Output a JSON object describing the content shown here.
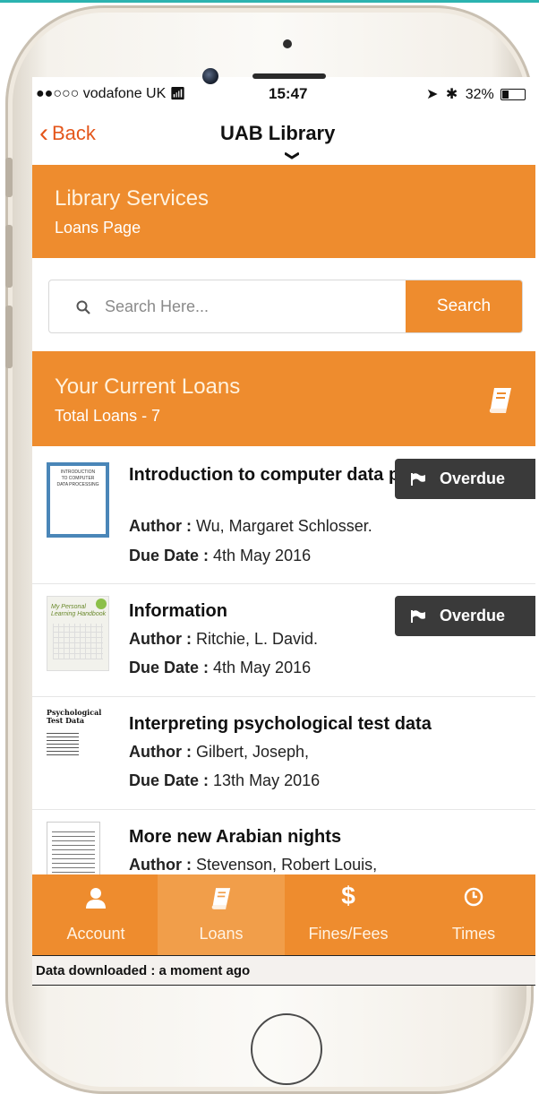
{
  "status_bar": {
    "carrier": "●●○○○ vodafone UK",
    "time": "15:47",
    "battery": "32%",
    "battery_level": 0.32
  },
  "nav": {
    "back_label": "Back",
    "title": "UAB Library"
  },
  "header": {
    "title": "Library Services",
    "subtitle": "Loans Page"
  },
  "search": {
    "placeholder": "Search Here...",
    "button_label": "Search"
  },
  "loans": {
    "title": "Your Current Loans",
    "total": "Total Loans - 7",
    "items": [
      {
        "title": "Introduction to computer data processing",
        "author_label": "Author :",
        "author": "Wu, Margaret Schlosser.",
        "due_label": "Due Date :",
        "due": "4th May 2016",
        "badge": "Overdue",
        "cover_lines": [
          "INTRODUCTION",
          "TO COMPUTER",
          "DATA PROCESSING"
        ]
      },
      {
        "title": "Information",
        "author_label": "Author :",
        "author": "Ritchie, L. David.",
        "due_label": "Due Date :",
        "due": "4th May 2016",
        "badge": "Overdue",
        "cover_lines": [
          "My Personal",
          "Learning Handbook"
        ]
      },
      {
        "title": "Interpreting psychological test data",
        "author_label": "Author :",
        "author": "Gilbert, Joseph,",
        "due_label": "Due Date :",
        "due": "13th May 2016",
        "badge": "",
        "cover_lines": [
          "Psychological",
          "Test Data"
        ]
      },
      {
        "title": "More new Arabian nights",
        "author_label": "Author :",
        "author": "Stevenson, Robert Louis,",
        "due_label": "",
        "due": "",
        "badge": "",
        "cover_lines": []
      }
    ]
  },
  "tabs": [
    {
      "label": "Account",
      "icon": "user-icon"
    },
    {
      "label": "Loans",
      "icon": "book-icon",
      "active": true
    },
    {
      "label": "Fines/Fees",
      "icon": "dollar-icon"
    },
    {
      "label": "Times",
      "icon": "clock-icon"
    }
  ],
  "footer": {
    "text": "Data downloaded : a moment ago"
  },
  "colors": {
    "accent": "#ee8c2e",
    "accent_active": "#f19e4a",
    "back_link": "#e4561b",
    "badge": "#3a3a3a"
  }
}
